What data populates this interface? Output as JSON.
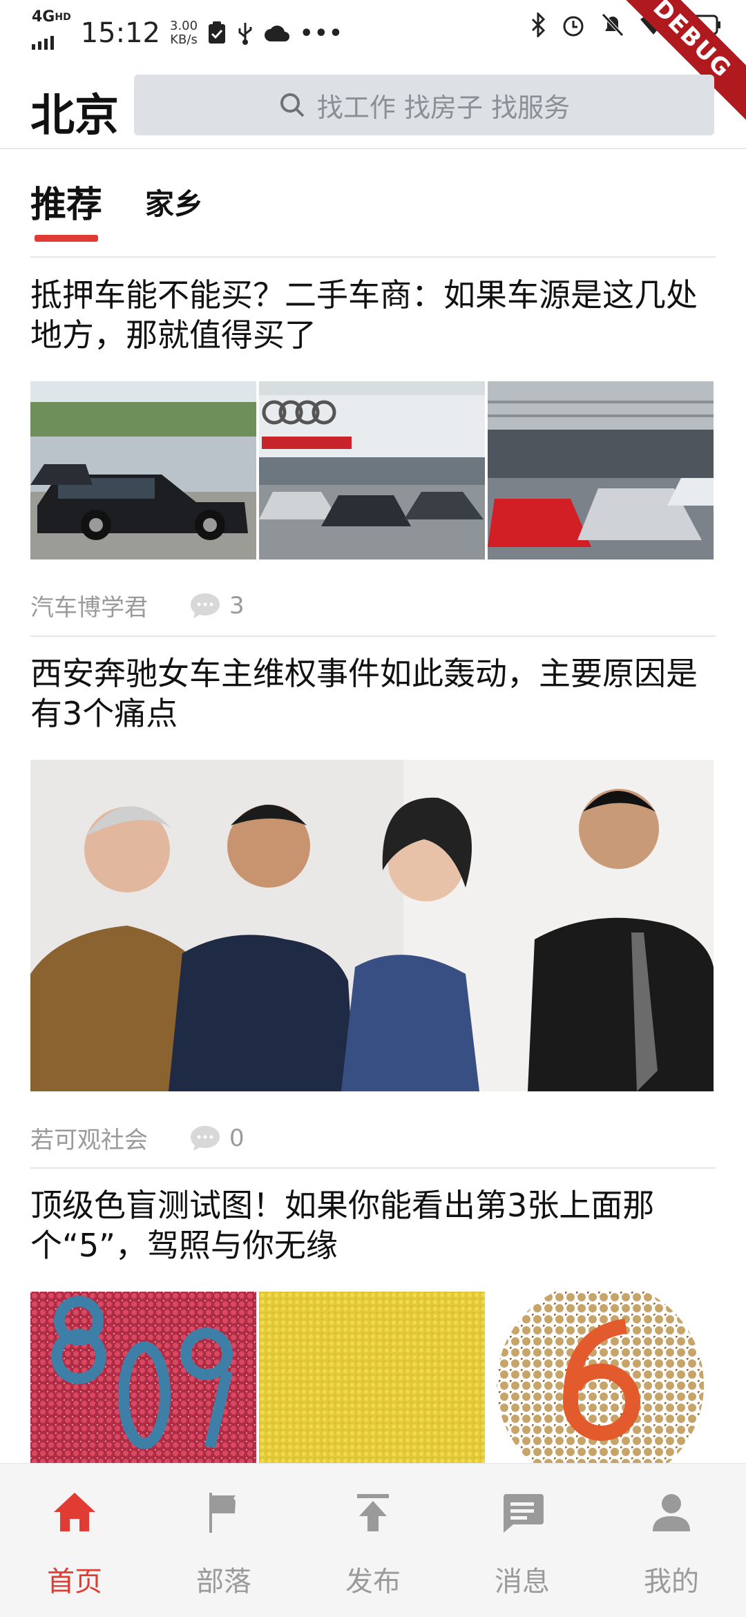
{
  "status_bar": {
    "network": "4G",
    "network_sup": "HD",
    "time": "15:12",
    "speed_value": "3.00",
    "speed_unit": "KB/s",
    "debug_label": "DEBUG"
  },
  "header": {
    "city": "北京",
    "search_placeholder": "找工作 找房子 找服务"
  },
  "tabs": [
    {
      "label": "推荐",
      "active": true
    },
    {
      "label": "家乡",
      "active": false
    }
  ],
  "articles": [
    {
      "title": "抵押车能不能买？二手车商：如果车源是这几处地方，那就值得买了",
      "source": "汽车博学君",
      "comments": "3",
      "image_alts": [
        "parking-lot-black-sedan",
        "audi-dealership",
        "car-storage-hall"
      ]
    },
    {
      "title": "西安奔驰女车主维权事件如此轰动，主要原因是有3个痛点",
      "source": "若可观社会",
      "comments": "0",
      "image_alts": [
        "group-photo-four-people"
      ]
    },
    {
      "title": "顶级色盲测试图！如果你能看出第3张上面那个“5”，驾照与你无缘",
      "source": "",
      "comments": "",
      "image_alts": [
        "color-plate-809",
        "color-plate-yellow",
        "color-plate-6"
      ]
    }
  ],
  "bottom_nav": [
    {
      "label": "首页",
      "icon": "home-icon",
      "active": true
    },
    {
      "label": "部落",
      "icon": "flag-icon",
      "active": false
    },
    {
      "label": "发布",
      "icon": "upload-icon",
      "active": false
    },
    {
      "label": "消息",
      "icon": "message-icon",
      "active": false
    },
    {
      "label": "我的",
      "icon": "person-icon",
      "active": false
    }
  ],
  "colors": {
    "accent": "#e03c33",
    "search_bg": "#dde1e5",
    "nav_bg": "#f5f5f5",
    "muted_text": "#9a9a9a"
  }
}
